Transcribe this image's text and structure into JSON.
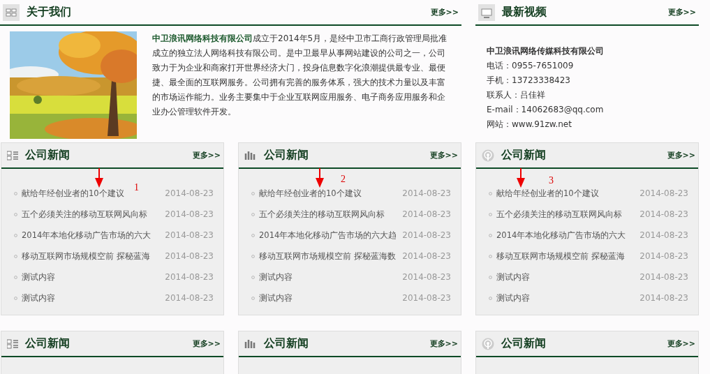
{
  "about": {
    "title": "关于我们",
    "more": "更多>>",
    "text": "**中卫浪讯网络科技有限公司**成立于2014年5月，是经中卫市工商行政管理局批准成立的独立法人网络科技有限公司。是中卫最早从事网站建设的公司之一，公司致力于为企业和商家打开世界经济大门，投身信息数字化浪潮提供最专业、最便捷、最全面的互联网服务。公司拥有完善的服务体系，强大的技术力量以及丰富的市场运作能力。业务主要集中于企业互联网应用服务、电子商务应用服务和企业办公管理软件开发。"
  },
  "video": {
    "title": "最新视频",
    "more": "更多>>",
    "company": "中卫浪讯网络传媒科技有限公司",
    "lines": [
      "电话：0955-7651009",
      "手机：13723338423",
      "联系人：吕佳祥",
      "E-mail：14062683@qq.com",
      "网站：www.91zw.net"
    ]
  },
  "news_panels": [
    {
      "title": "公司新闻",
      "more": "更多>>",
      "kind": "list",
      "annotation": "1",
      "items": [
        {
          "title": "献给年经创业者的10个建议",
          "date": "2014-08-23"
        },
        {
          "title": "五个必须关注的移动互联网风向标",
          "date": "2014-08-23"
        },
        {
          "title": "2014年本地化移动广告市场的六大",
          "date": "2014-08-23"
        },
        {
          "title": "移动互联网市场规模空前 探秘蓝海",
          "date": "2014-08-23"
        },
        {
          "title": "测试内容",
          "date": "2014-08-23"
        },
        {
          "title": "测试内容",
          "date": "2014-08-23"
        }
      ]
    },
    {
      "title": "公司新闻",
      "more": "更多>>",
      "kind": "bars",
      "annotation": "2",
      "items": [
        {
          "title": "献给年经创业者的10个建议",
          "date": "2014-08-23"
        },
        {
          "title": "五个必须关注的移动互联网风向标",
          "date": "2014-08-23"
        },
        {
          "title": "2014年本地化移动广告市场的六大趋",
          "date": "2014-08-23"
        },
        {
          "title": "移动互联网市场规模空前 探秘蓝海数",
          "date": "2014-08-23"
        },
        {
          "title": "测试内容",
          "date": "2014-08-23"
        },
        {
          "title": "测试内容",
          "date": "2014-08-23"
        }
      ]
    },
    {
      "title": "公司新闻",
      "more": "更多>>",
      "kind": "signal",
      "annotation": "3",
      "items": [
        {
          "title": "献给年经创业者的10个建议",
          "date": "2014-08-23"
        },
        {
          "title": "五个必须关注的移动互联网风向标",
          "date": "2014-08-23"
        },
        {
          "title": "2014年本地化移动广告市场的六大",
          "date": "2014-08-23"
        },
        {
          "title": "移动互联网市场规模空前 探秘蓝海",
          "date": "2014-08-23"
        },
        {
          "title": "测试内容",
          "date": "2014-08-23"
        },
        {
          "title": "测试内容",
          "date": "2014-08-23"
        }
      ]
    },
    {
      "title": "公司新闻",
      "more": "更多>>",
      "kind": "list"
    },
    {
      "title": "公司新闻",
      "more": "更多>>",
      "kind": "bars"
    },
    {
      "title": "公司新闻",
      "more": "更多>>",
      "kind": "signal"
    }
  ]
}
